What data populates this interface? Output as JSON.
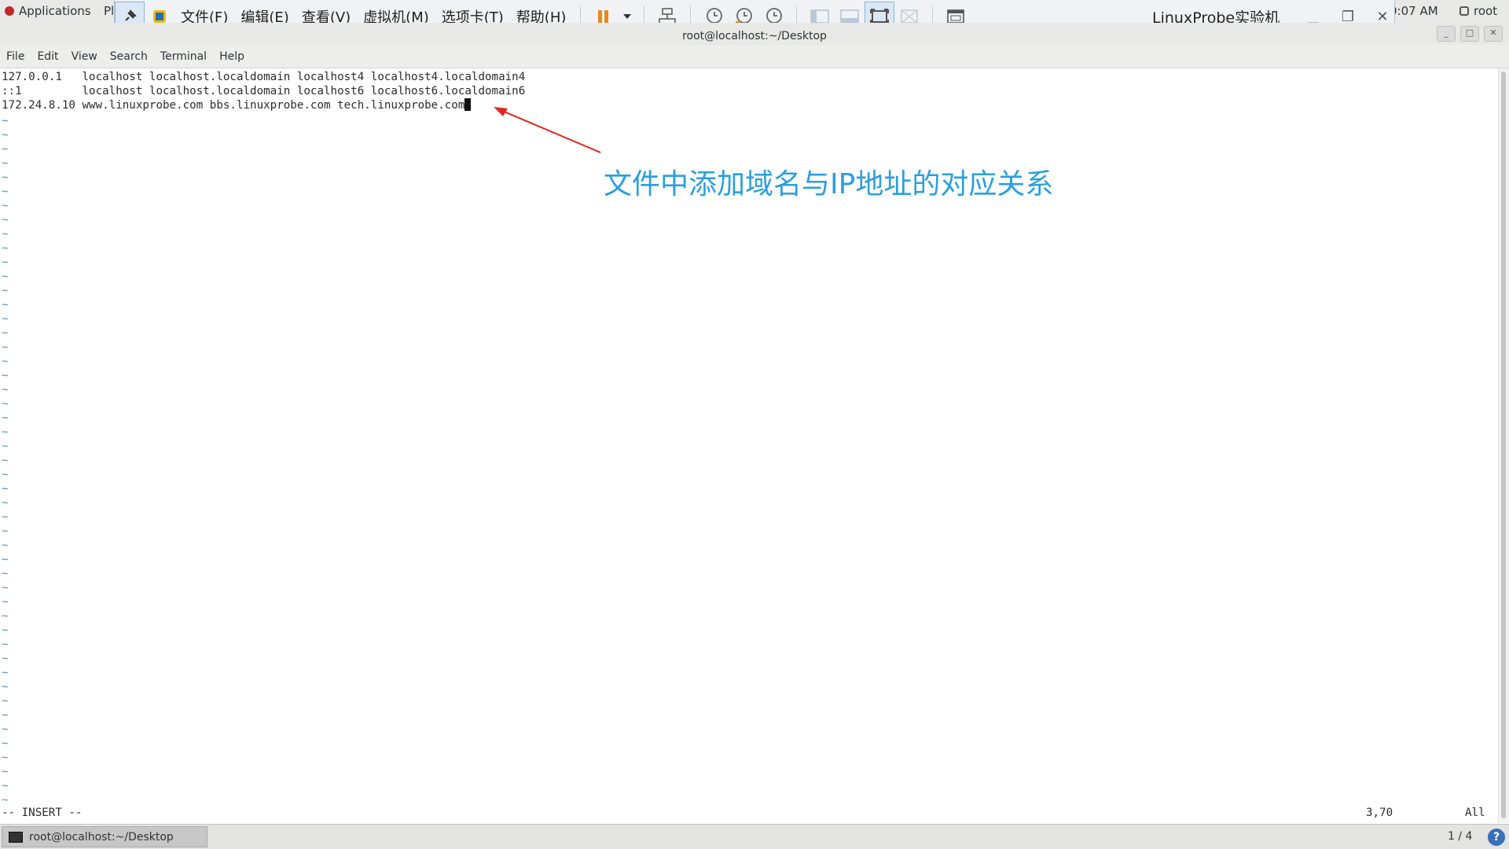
{
  "topbar": {
    "applications": "Applications",
    "places": "Pl",
    "clock": "0:07 AM",
    "user": "root"
  },
  "vmware": {
    "menus": [
      "文件(F)",
      "编辑(E)",
      "查看(V)",
      "虚拟机(M)",
      "选项卡(T)",
      "帮助(H)"
    ],
    "title": "LinuxProbe实验机"
  },
  "terminal": {
    "title": "root@localhost:~/Desktop",
    "menu": [
      "File",
      "Edit",
      "View",
      "Search",
      "Terminal",
      "Help"
    ],
    "lines": [
      "127.0.0.1   localhost localhost.localdomain localhost4 localhost4.localdomain4",
      "::1         localhost localhost.localdomain localhost6 localhost6.localdomain6",
      "172.24.8.10 www.linuxprobe.com bbs.linuxprobe.com tech.linuxprobe.com"
    ],
    "tilde": "~",
    "status_mode": "-- INSERT --",
    "status_position": "3,70",
    "status_scroll": "All"
  },
  "annotation": {
    "text": "文件中添加域名与IP地址的对应关系",
    "color": "#2a9fe0",
    "arrow_color": "#e0271f"
  },
  "taskbar": {
    "task_label": "root@localhost:~/Desktop",
    "workspace": "1 / 4",
    "help": "?"
  }
}
